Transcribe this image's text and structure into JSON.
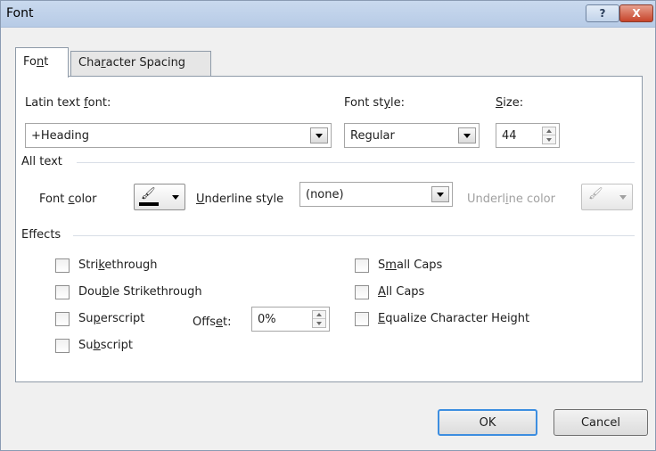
{
  "window": {
    "title": "Font",
    "help_glyph": "?",
    "close_glyph": "X"
  },
  "tabs": [
    {
      "label_pre": "Fo",
      "label_u": "n",
      "label_post": "t"
    },
    {
      "label_pre": "Cha",
      "label_u": "r",
      "label_post": "acter Spacing"
    }
  ],
  "latin_font": {
    "label_pre": "Latin text ",
    "label_u": "f",
    "label_post": "ont:",
    "value": "+Heading"
  },
  "font_style": {
    "label_pre": "Font st",
    "label_u": "y",
    "label_post": "le:",
    "value": "Regular"
  },
  "size": {
    "label_u": "S",
    "label_post": "ize:",
    "value": "44"
  },
  "all_text": {
    "group_label": "All text",
    "font_color_label_pre": "Font ",
    "font_color_label_u": "c",
    "font_color_label_post": "olor",
    "font_color_hex": "#000000",
    "underline_style_label_u": "U",
    "underline_style_label_post": "nderline style",
    "underline_style_value": "(none)",
    "underline_color_label_pre": "Underl",
    "underline_color_label_u": "i",
    "underline_color_label_post": "ne color"
  },
  "effects": {
    "group_label": "Effects",
    "strikethrough": {
      "pre": "Stri",
      "u": "k",
      "post": "ethrough"
    },
    "double_strikethrough": {
      "pre": "Dou",
      "u": "b",
      "post": "le Strikethrough"
    },
    "superscript": {
      "pre": "Su",
      "u": "p",
      "post": "erscript"
    },
    "subscript": {
      "pre": "Su",
      "u": "b",
      "post": "script"
    },
    "offset": {
      "pre": "Offs",
      "u": "e",
      "post": "t:",
      "value": "0%"
    },
    "small_caps": {
      "pre": "S",
      "u": "m",
      "post": "all Caps"
    },
    "all_caps": {
      "pre": "",
      "u": "A",
      "post": "ll Caps"
    },
    "equalize": {
      "pre": "",
      "u": "E",
      "post": "qualize Character Height"
    }
  },
  "buttons": {
    "ok": "OK",
    "cancel": "Cancel"
  }
}
